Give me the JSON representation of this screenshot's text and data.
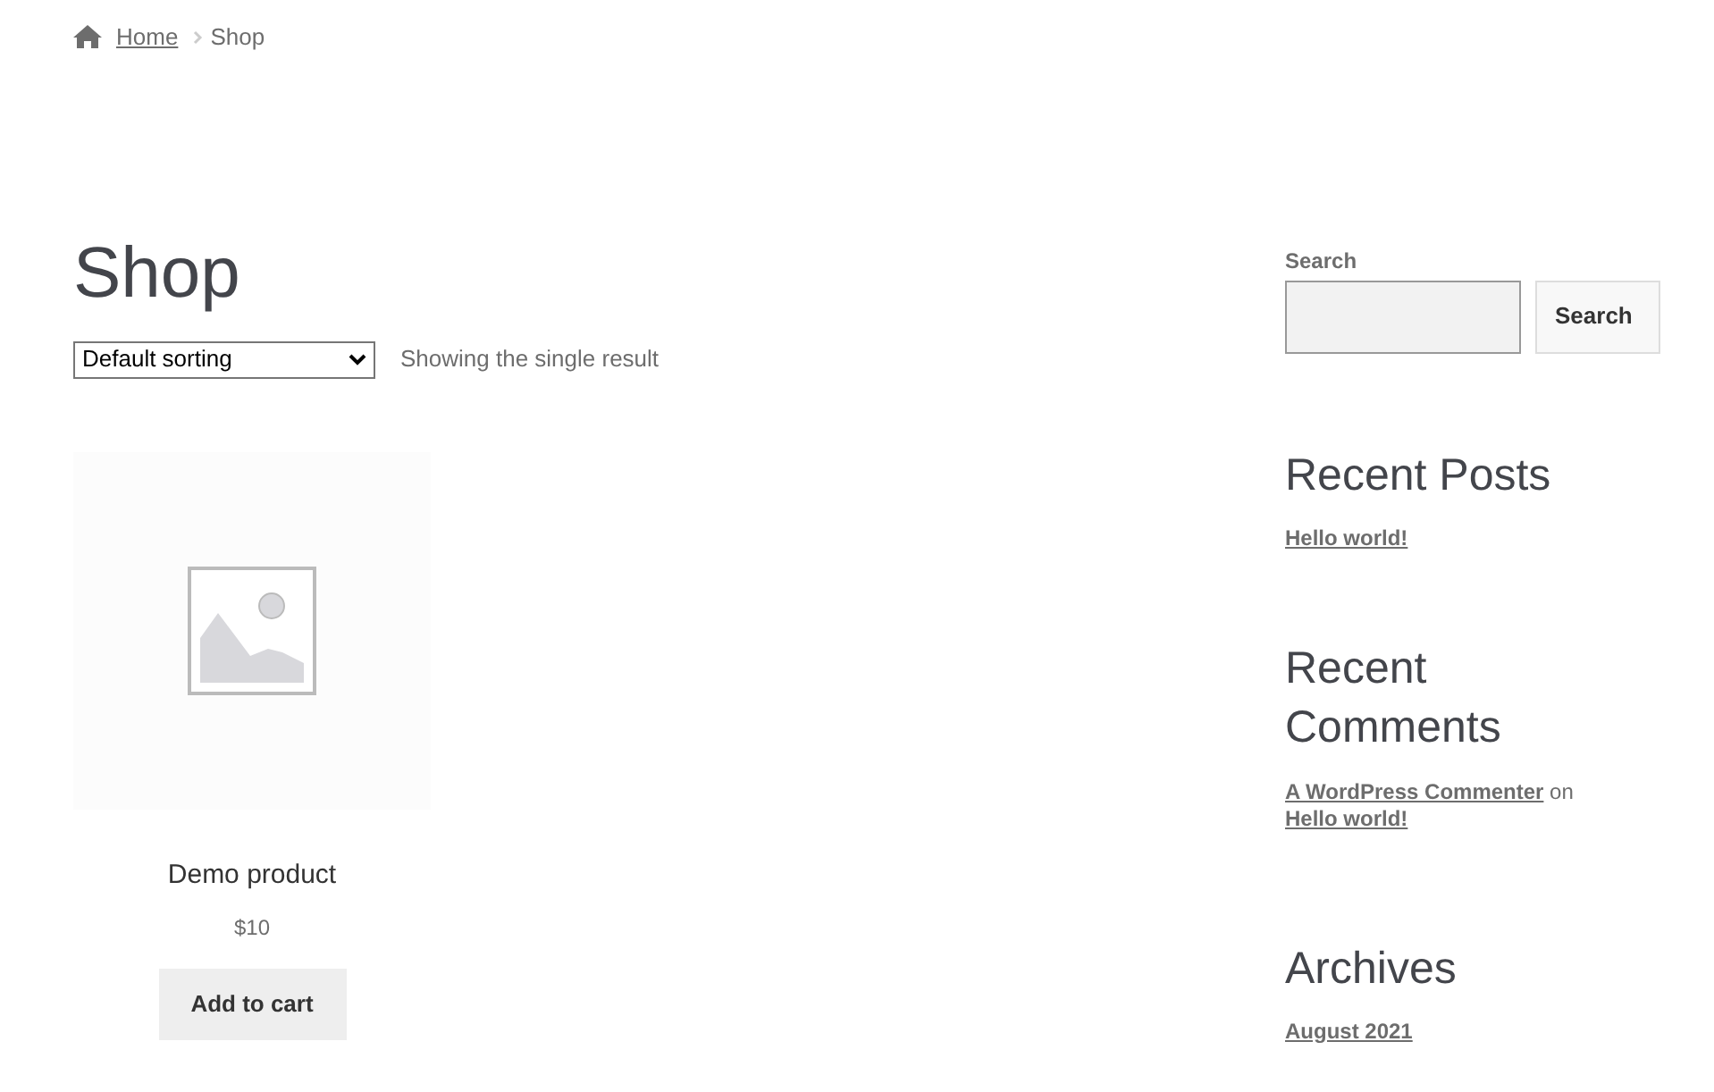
{
  "breadcrumb": {
    "items": [
      {
        "label": "Home",
        "kind": "link"
      },
      {
        "label": "Shop",
        "kind": "current"
      }
    ]
  },
  "page_title": "Shop",
  "sorting": {
    "value": "Default sorting"
  },
  "result_count": "Showing the single result",
  "products": [
    {
      "name": "Demo product",
      "price": "$10",
      "button": "Add to cart"
    }
  ],
  "sidebar": {
    "search": {
      "label": "Search",
      "button": "Search"
    },
    "recent_posts": {
      "title": "Recent Posts",
      "items": [
        "Hello world!"
      ]
    },
    "recent_comments": {
      "title": "Recent Comments",
      "items": [
        {
          "author": "A WordPress Commenter",
          "joiner": "on",
          "post": "Hello world!"
        }
      ]
    },
    "archives": {
      "title": "Archives",
      "items": [
        "August 2021"
      ]
    }
  }
}
